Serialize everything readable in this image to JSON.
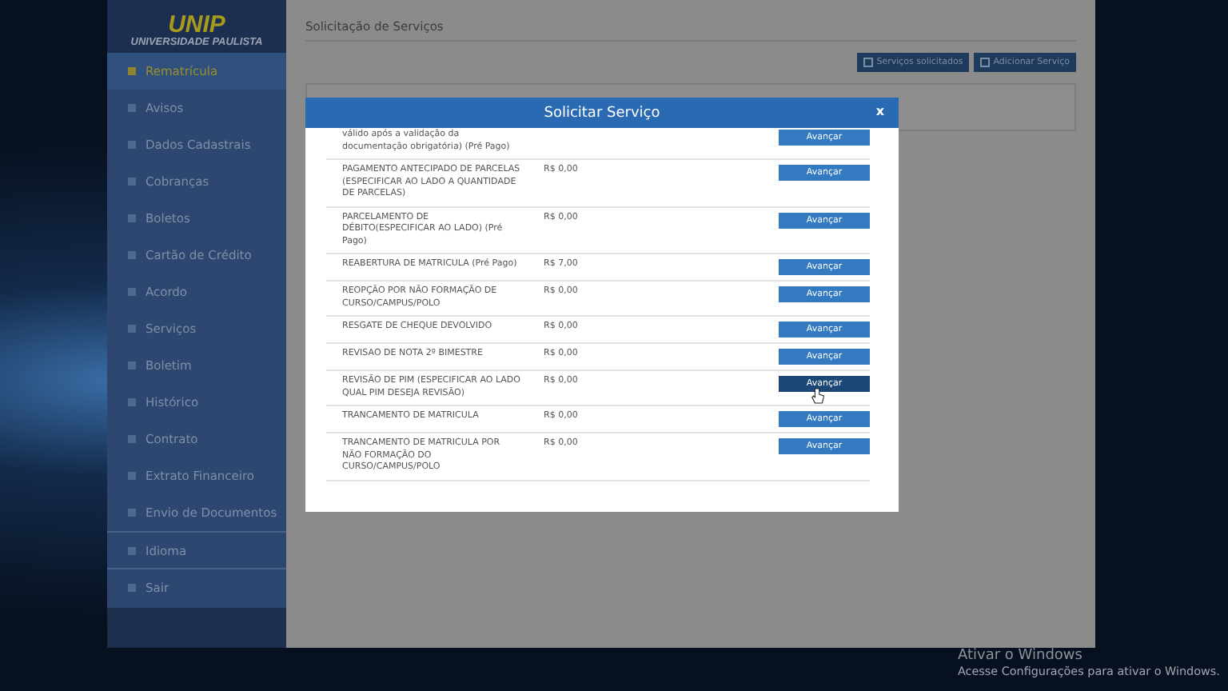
{
  "logo": {
    "title": "UNIP",
    "subtitle": "UNIVERSIDADE PAULISTA"
  },
  "sidebar": {
    "items": [
      {
        "label": "Rematrícula",
        "selected": true
      },
      {
        "label": "Avisos",
        "selected": false
      },
      {
        "label": "Dados Cadastrais",
        "selected": false
      },
      {
        "label": "Cobranças",
        "selected": false
      },
      {
        "label": "Boletos",
        "selected": false
      },
      {
        "label": "Cartão de Crédito",
        "selected": false
      },
      {
        "label": "Acordo",
        "selected": false
      },
      {
        "label": "Serviços",
        "selected": false
      },
      {
        "label": "Boletim",
        "selected": false
      },
      {
        "label": "Histórico",
        "selected": false
      },
      {
        "label": "Contrato",
        "selected": false
      },
      {
        "label": "Extrato Financeiro",
        "selected": false
      },
      {
        "label": "Envio de Documentos",
        "selected": false
      },
      {
        "label": "Idioma",
        "selected": false
      },
      {
        "label": "Sair",
        "selected": false
      }
    ]
  },
  "page": {
    "title": "Solicitação de Serviços",
    "buttons": [
      "Serviços solicitados",
      "Adicionar Serviço"
    ]
  },
  "modal": {
    "title": "Solicitar Serviço",
    "close": "x",
    "rows": [
      {
        "service": "válido após a validação da documentação obrigatória) (Pré Pago)",
        "action": "Avançar",
        "hovered": false
      },
      {
        "service": "PAGAMENTO ANTECIPADO DE PARCELAS (ESPECIFICAR AO LADO A QUANTIDADE DE PARCELAS)",
        "price": "R$ 0,00",
        "action": "Avançar",
        "hovered": false
      },
      {
        "service": "PARCELAMENTO DE DÉBITO(ESPECIFICAR AO LADO) (Pré Pago)",
        "price": "R$ 0,00",
        "action": "Avançar",
        "hovered": false
      },
      {
        "service": "REABERTURA DE MATRICULA (Pré Pago)",
        "price": "R$ 7,00",
        "action": "Avançar",
        "hovered": false
      },
      {
        "service": "REOPÇÃO POR NÃO FORMAÇÃO DE CURSO/CAMPUS/POLO",
        "price": "R$ 0,00",
        "action": "Avançar",
        "hovered": false
      },
      {
        "service": "RESGATE DE CHEQUE DEVOLVIDO",
        "price": "R$ 0,00",
        "action": "Avançar",
        "hovered": false
      },
      {
        "service": "REVISAO DE NOTA 2º BIMESTRE",
        "price": "R$ 0,00",
        "action": "Avançar",
        "hovered": false
      },
      {
        "service": "REVISÃO DE PIM (ESPECIFICAR AO LADO QUAL PIM DESEJA REVISÃO)",
        "price": "R$ 0,00",
        "action": "Avançar",
        "hovered": true
      },
      {
        "service": "TRANCAMENTO DE MATRICULA",
        "price": "R$ 0,00",
        "action": "Avançar",
        "hovered": false
      },
      {
        "service": "TRANCAMENTO DE MATRICULA POR NÃO FORMAÇÃO DO CURSO/CAMPUS/POLO",
        "price": "R$ 0,00",
        "action": "Avançar",
        "hovered": false
      }
    ]
  },
  "activation": {
    "title": "Ativar o Windows",
    "message": "Acesse Configurações para ativar o Windows."
  }
}
